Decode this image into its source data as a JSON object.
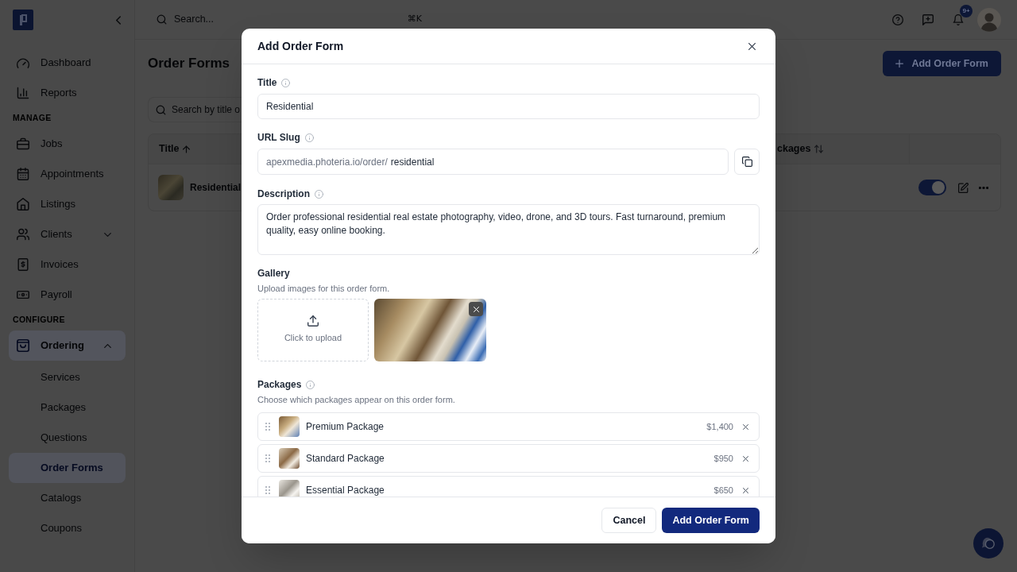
{
  "sidebar": {
    "items": [
      {
        "kind": "link",
        "label": "Dashboard",
        "selected": false
      },
      {
        "kind": "link",
        "label": "Reports",
        "selected": false
      },
      {
        "kind": "heading",
        "label": "MANAGE"
      },
      {
        "kind": "link",
        "label": "Jobs",
        "selected": false
      },
      {
        "kind": "link",
        "label": "Appointments",
        "selected": false
      },
      {
        "kind": "link",
        "label": "Listings",
        "selected": false
      },
      {
        "kind": "group",
        "label": "Clients",
        "selected": false,
        "expanded": false
      },
      {
        "kind": "link",
        "label": "Invoices",
        "selected": false
      },
      {
        "kind": "link",
        "label": "Payroll",
        "selected": false
      },
      {
        "kind": "heading",
        "label": "CONFIGURE"
      },
      {
        "kind": "group",
        "label": "Ordering",
        "selected": true,
        "expanded": true,
        "children": [
          {
            "label": "Services",
            "selected": false
          },
          {
            "label": "Packages",
            "selected": false
          },
          {
            "label": "Questions",
            "selected": false
          },
          {
            "label": "Order Forms",
            "selected": true
          },
          {
            "label": "Catalogs",
            "selected": false
          },
          {
            "label": "Coupons",
            "selected": false
          }
        ]
      }
    ]
  },
  "topbar": {
    "search": {
      "placeholder": "Search...",
      "shortcut": "⌘K"
    },
    "notifications_badge": "9+"
  },
  "page": {
    "title": "Order Forms",
    "add_button": "Add Order Form",
    "search": {
      "placeholder": "Search by title o"
    },
    "table": {
      "columns": [
        {
          "label": "Title",
          "sorted": true
        },
        {
          "label": "ckages",
          "sorted": false
        }
      ],
      "rows": [
        {
          "title": "Residential",
          "enabled": true
        }
      ]
    }
  },
  "dialog": {
    "title": "Add Order Form",
    "title_field": {
      "label": "Title",
      "info": true,
      "value": "Residential"
    },
    "slug_field": {
      "label": "URL Slug",
      "info": true,
      "prefix": "apexmedia.photeria.io/order/",
      "value": "residential"
    },
    "description_field": {
      "label": "Description",
      "info": true,
      "value": "Order professional residential real estate photography, video, drone, and 3D tours. Fast turnaround, premium quality, easy online booking."
    },
    "gallery": {
      "label": "Gallery",
      "hint": "Upload images for this order form.",
      "upload_label": "Click to upload",
      "images": [
        {
          "kind": "photo"
        }
      ]
    },
    "packages": {
      "label": "Packages",
      "info": true,
      "hint": "Choose which packages appear on this order form.",
      "items": [
        {
          "name": "Premium Package",
          "price": "$1,400"
        },
        {
          "name": "Standard Package",
          "price": "$950"
        },
        {
          "name": "Essential Package",
          "price": "$650"
        }
      ]
    },
    "buttons": [
      {
        "label": "Cancel",
        "kind": "secondary"
      },
      {
        "label": "Add Order Form",
        "kind": "primary"
      }
    ]
  }
}
